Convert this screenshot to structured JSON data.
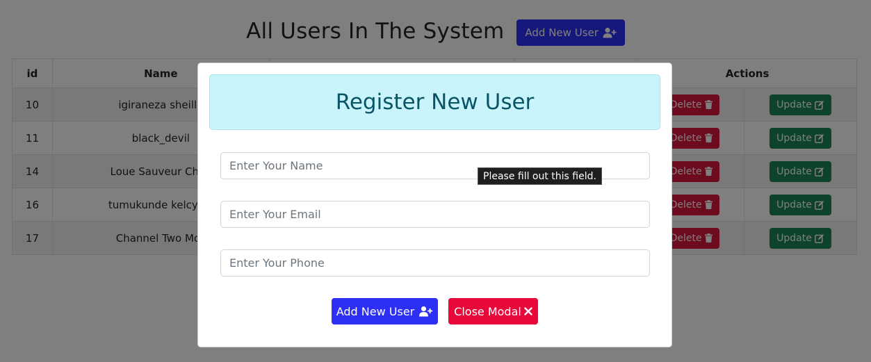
{
  "page": {
    "title": "All Users In The System",
    "add_button_label": "Add New User"
  },
  "table": {
    "headers": {
      "id": "id",
      "name": "Name",
      "actions": "Actions"
    },
    "rows": [
      {
        "id": "10",
        "name": "igiraneza sheilla"
      },
      {
        "id": "11",
        "name": "black_devil"
      },
      {
        "id": "14",
        "name": "Loue Sauveur Chris"
      },
      {
        "id": "16",
        "name": "tumukunde kelcy sh"
      },
      {
        "id": "17",
        "name": "Channel Two Mos"
      }
    ],
    "delete_label": "Delete",
    "update_label": "Update"
  },
  "modal": {
    "title": "Register New User",
    "name_placeholder": "Enter Your Name",
    "email_placeholder": "Enter Your Email",
    "phone_placeholder": "Enter Your Phone",
    "tooltip": "Please fill out this field.",
    "add_button_label": "Add New User",
    "close_button_label": "Close Modal"
  },
  "colors": {
    "primary": "#2d2ff5",
    "danger": "#dc143c",
    "success": "#198754",
    "modal_header_bg": "#caf4fb",
    "modal_title": "#085567"
  },
  "icons": {
    "add_user": "user-plus-icon",
    "delete": "trash-icon",
    "update": "edit-icon",
    "close": "close-icon"
  }
}
